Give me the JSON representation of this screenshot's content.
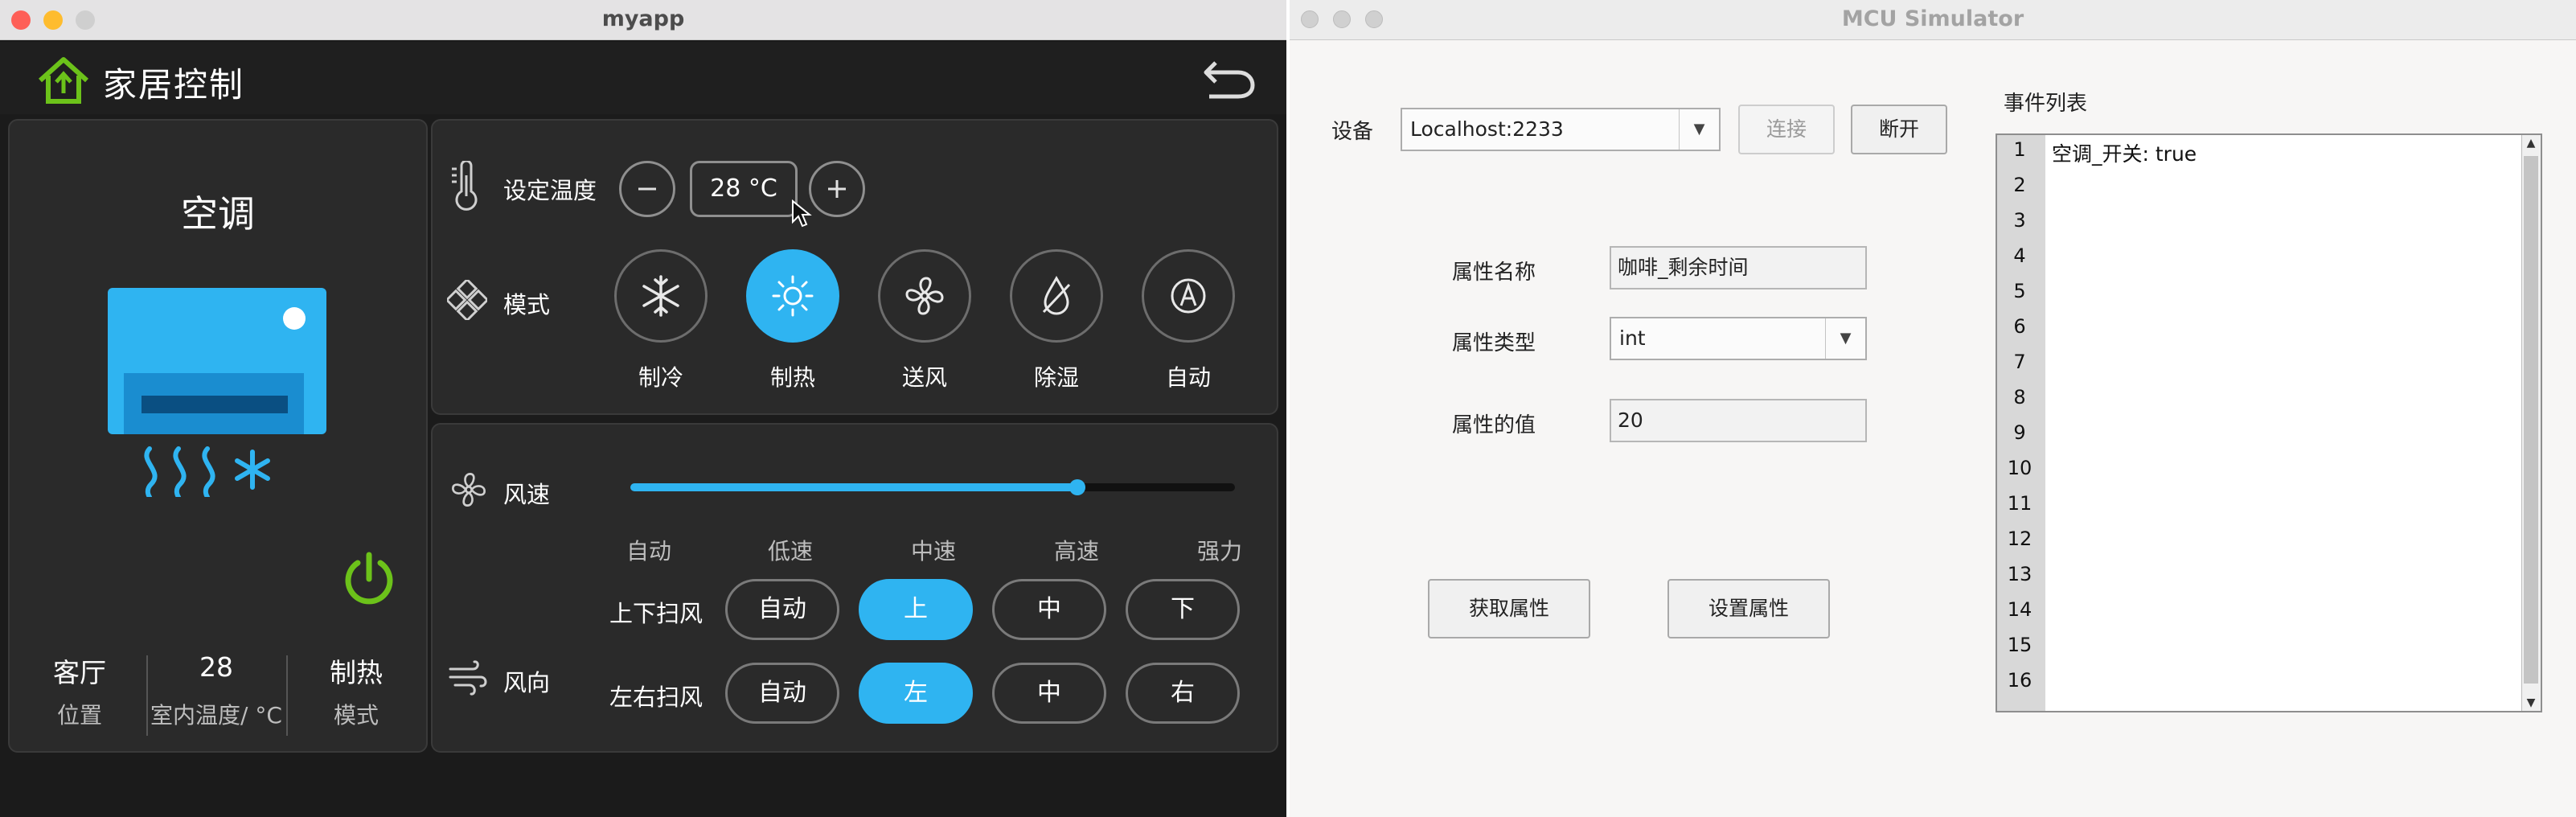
{
  "myapp": {
    "window_title": "myapp",
    "header": {
      "title": "家居控制",
      "home_icon": "home-icon",
      "back_icon": "back-arrow-icon"
    },
    "device": {
      "name": "空调",
      "power_icon": "power-icon",
      "status": [
        {
          "value": "客厅",
          "label": "位置"
        },
        {
          "value": "28",
          "label": "室内温度/ °C"
        },
        {
          "value": "制热",
          "label": "模式"
        }
      ]
    },
    "temperature": {
      "label": "设定温度",
      "value": "28 °C",
      "minus": "−",
      "plus": "+"
    },
    "mode": {
      "label": "模式",
      "selected": "制热",
      "options": [
        {
          "label": "制冷",
          "icon": "snowflake-icon"
        },
        {
          "label": "制热",
          "icon": "sun-icon"
        },
        {
          "label": "送风",
          "icon": "fan-icon"
        },
        {
          "label": "除湿",
          "icon": "droplet-icon"
        },
        {
          "label": "自动",
          "icon": "auto-icon"
        }
      ]
    },
    "wind_speed": {
      "label": "风速",
      "levels": [
        "自动",
        "低速",
        "中速",
        "高速",
        "强力"
      ],
      "level_fraction": 0.74
    },
    "wind_direction": {
      "label": "风向",
      "vertical": {
        "label": "上下扫风",
        "options": [
          "自动",
          "上",
          "中",
          "下"
        ],
        "selected": "上"
      },
      "horizontal": {
        "label": "左右扫风",
        "options": [
          "自动",
          "左",
          "中",
          "右"
        ],
        "selected": "左"
      }
    },
    "colors": {
      "accent": "#2fb4f1",
      "power": "#6cc21a",
      "home": "#6cc21a",
      "panel": "#2a2a2a",
      "bg": "#1b1b1b"
    }
  },
  "mcu": {
    "window_title": "MCU Simulator",
    "device_label": "设备",
    "device_value": "Localhost:2233",
    "connect_label": "连接",
    "disconnect_label": "断开",
    "prop_name_label": "属性名称",
    "prop_name_value": "咖啡_剩余时间",
    "prop_type_label": "属性类型",
    "prop_type_value": "int",
    "prop_value_label": "属性的值",
    "prop_value_value": "20",
    "get_button": "获取属性",
    "set_button": "设置属性",
    "event_list_label": "事件列表",
    "event_lines": [
      "1",
      "2",
      "3",
      "4",
      "5",
      "6",
      "7",
      "8",
      "9",
      "10",
      "11",
      "12",
      "13",
      "14",
      "15",
      "16"
    ],
    "event_text": "空调_开关: true"
  }
}
